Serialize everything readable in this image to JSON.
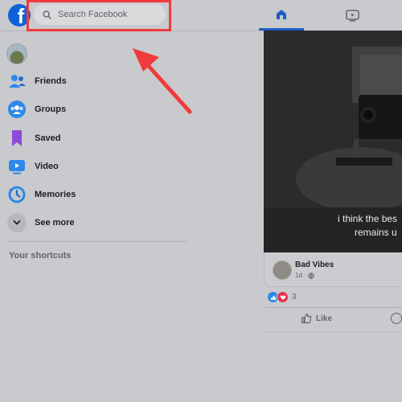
{
  "header": {
    "logo_letter": "f",
    "search": {
      "placeholder": "Search Facebook",
      "value": ""
    }
  },
  "sidebar": {
    "items": [
      {
        "label": "Friends",
        "icon": "friends-icon"
      },
      {
        "label": "Groups",
        "icon": "groups-icon"
      },
      {
        "label": "Saved",
        "icon": "saved-icon"
      },
      {
        "label": "Video",
        "icon": "video-icon"
      },
      {
        "label": "Memories",
        "icon": "memories-icon"
      },
      {
        "label": "See more",
        "icon": "chevron-down-icon"
      }
    ],
    "shortcuts_heading": "Your shortcuts"
  },
  "post": {
    "caption_line1": "i think the bes",
    "caption_line2": "remains u",
    "author": "Bad Vibes",
    "time": "1d ·",
    "reaction_count": "3",
    "like_label": "Like"
  },
  "colors": {
    "accent": "#1b5fc4",
    "highlight": "#ef3b3b",
    "background": "#c9cacd"
  }
}
